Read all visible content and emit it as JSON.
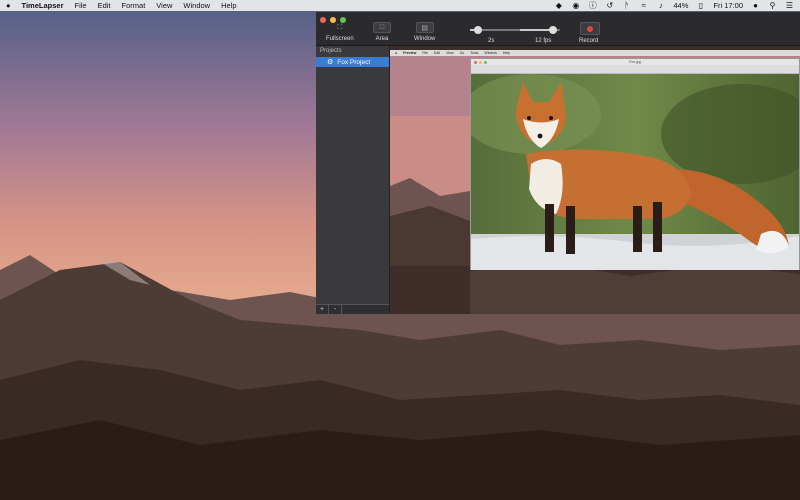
{
  "menubar": {
    "apple": "",
    "app_name": "TimeLapser",
    "items": [
      "File",
      "Edit",
      "Format",
      "View",
      "Window",
      "Help"
    ],
    "battery": "44%",
    "clock": "Fri 17:00"
  },
  "toolbar": {
    "fullscreen_label": "Fullscreen",
    "area_label": "Area",
    "window_label": "Window",
    "interval_label": "2s",
    "interval_fraction": 0.15,
    "fps_label": "12 fps",
    "fps_fraction": 0.82,
    "record_label": "Record"
  },
  "sidebar": {
    "heading": "Projects",
    "items": [
      {
        "label": "Fox Project",
        "selected": true
      }
    ],
    "add_label": "+",
    "remove_label": "-"
  },
  "preview": {
    "menubar_items": [
      "Preview",
      "File",
      "Edit",
      "View",
      "Go",
      "Tools",
      "Window",
      "Help"
    ],
    "window_title": "Fox.jpg"
  },
  "colors": {
    "selection": "#3a7bd5",
    "record": "#d84a3a",
    "toolbar_bg": "#2b2b2d"
  }
}
